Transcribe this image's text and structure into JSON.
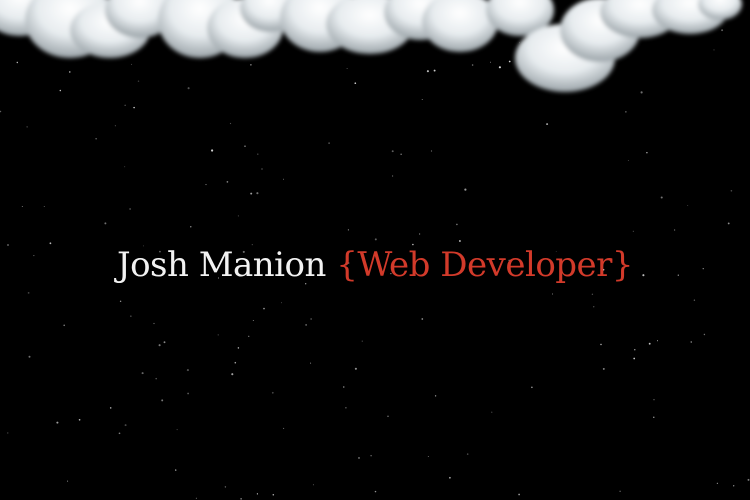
{
  "hero": {
    "name": "Josh Manion",
    "role": "{Web Developer}",
    "name_color": "#f2f2f2",
    "role_color": "#d23a2a"
  },
  "background": {
    "color": "#000000",
    "stars_color": "#ffffff",
    "clouds_color": "#e9eef1"
  }
}
